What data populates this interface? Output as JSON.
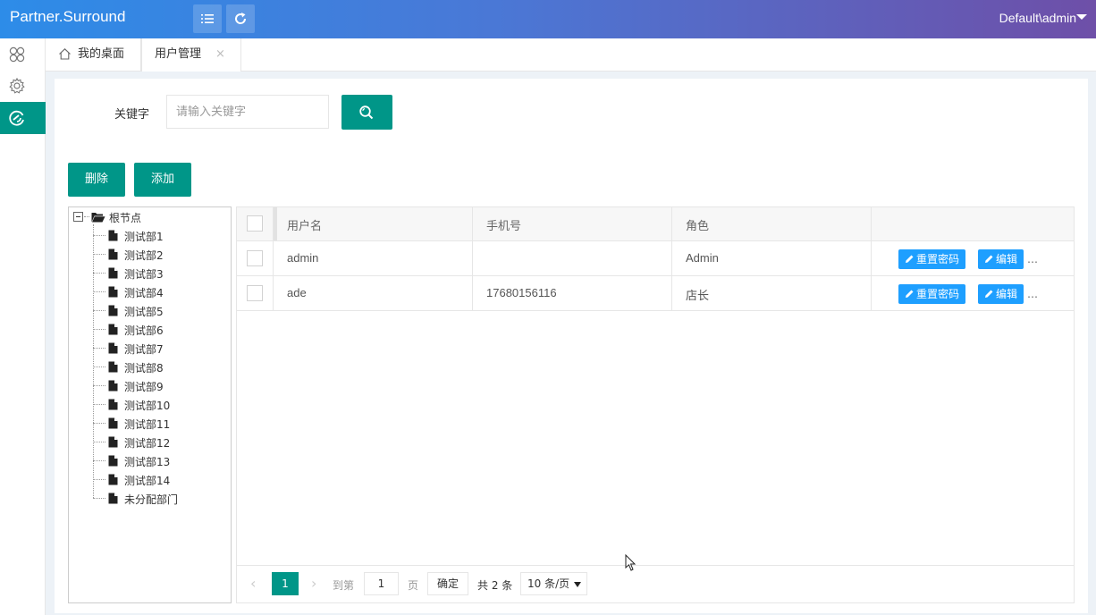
{
  "header": {
    "logo": "Partner.Surround",
    "user": "Default\\admin"
  },
  "tabs": [
    {
      "label": "我的桌面"
    },
    {
      "label": "用户管理",
      "close": "×"
    }
  ],
  "search": {
    "label": "关键字",
    "placeholder": "请输入关键字"
  },
  "actions": {
    "delete_label": "删除",
    "add_label": "添加"
  },
  "tree": {
    "root": "根节点",
    "nodes": [
      "测试部1",
      "测试部2",
      "测试部3",
      "测试部4",
      "测试部5",
      "测试部6",
      "测试部7",
      "测试部8",
      "测试部9",
      "测试部10",
      "测试部11",
      "测试部12",
      "测试部13",
      "测试部14",
      "未分配部门"
    ]
  },
  "table": {
    "columns": [
      "用户名",
      "手机号",
      "角色"
    ],
    "rows": [
      {
        "username": "admin",
        "phone": "",
        "role": "Admin",
        "reset": "重置密码",
        "edit": "编辑",
        "more": "…"
      },
      {
        "username": "ade",
        "phone": "17680156116",
        "role": "店长",
        "reset": "重置密码",
        "edit": "编辑",
        "more": "…"
      }
    ]
  },
  "pager": {
    "current": "1",
    "goto_label": "到第",
    "goto_value": "1",
    "page_unit": "页",
    "ok_label": "确定",
    "total": "共 2 条",
    "page_size": "10 条/页",
    "prev": "‹",
    "next": "›"
  },
  "colors": {
    "accent": "#009688",
    "blue": "#1e9fff",
    "header_from": "#2d8ce8",
    "header_to": "#6e4fa8"
  }
}
